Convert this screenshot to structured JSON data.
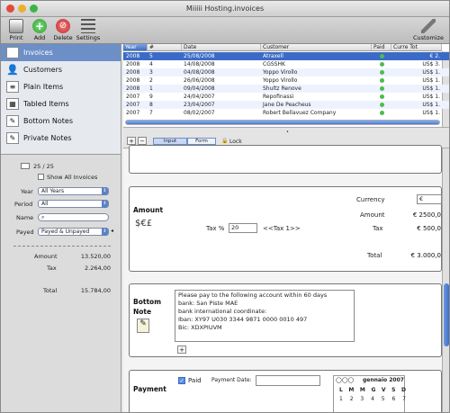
{
  "window": {
    "title": "Miiiii Hosting.invoices",
    "close_color": "#e04b3c",
    "min_color": "#e8b030",
    "max_color": "#3fb34a"
  },
  "toolbar": {
    "print": "Print",
    "add": "Add",
    "delete": "Delete",
    "settings": "Settings",
    "customize": "Customize"
  },
  "sidebar": {
    "items": [
      {
        "label": "Invoices",
        "icon": "invoice-icon"
      },
      {
        "label": "Customers",
        "icon": "person-icon"
      },
      {
        "label": "Plain Items",
        "icon": "document-icon"
      },
      {
        "label": "Tabled Items",
        "icon": "table-icon"
      },
      {
        "label": "Bottom Notes",
        "icon": "pencil-icon"
      },
      {
        "label": "Private Notes",
        "icon": "pencil-icon"
      }
    ]
  },
  "filter": {
    "count": "25 / 25",
    "show_all": "Show All Invoices",
    "year_label": "Year",
    "year_value": "All Years",
    "period_label": "Period",
    "period_value": "All",
    "name_label": "Name",
    "payed_label": "Payed",
    "payed_value": "Payed & Unpayed",
    "amount_label": "Amount",
    "amount_value": "13.520,00",
    "tax_label": "Tax",
    "tax_value": "2.264,00",
    "total_label": "Total",
    "total_value": "15.784,00"
  },
  "table": {
    "headers": [
      "Year",
      "#",
      "Date",
      "Customer",
      "Paid",
      "Curre Tot"
    ],
    "rows": [
      [
        "2008",
        "5",
        "25/08/2008",
        "Atraxell",
        "€ 2."
      ],
      [
        "2008",
        "4",
        "14/08/2008",
        "CGSSHK",
        "US$ 3."
      ],
      [
        "2008",
        "3",
        "04/08/2008",
        "Yoppo Virollo",
        "US$ 1."
      ],
      [
        "2008",
        "2",
        "26/06/2008",
        "Yoppo Virollo",
        "US$ 1."
      ],
      [
        "2008",
        "1",
        "09/04/2008",
        "Shultz Renove",
        "US$ 1."
      ],
      [
        "2007",
        "9",
        "24/04/2007",
        "Repofinassi",
        "US$ 1."
      ],
      [
        "2007",
        "8",
        "23/04/2007",
        "Jane De Peacheus",
        "US$ 1."
      ],
      [
        "2007",
        "7",
        "08/02/2007",
        "Robert Bellavuez Company",
        "US$ 1."
      ]
    ]
  },
  "tabbar": {
    "plus": "+",
    "minus": "−",
    "input": "Input",
    "form": "Form",
    "lock": "Lock"
  },
  "amount_section": {
    "title": "Amount",
    "currency_label": "Currency",
    "currency_value": "€",
    "amount_label": "Amount",
    "amount_value": "€  2500,0",
    "tax_pct_label": "Tax %",
    "tax_pct_value": "20",
    "tax_tag": "<<Tax 1>>",
    "tax_label": "Tax",
    "tax_value": "€  500,0",
    "total_label": "Total",
    "total_value": "€  3.000,0",
    "currency_symbols": "$€£"
  },
  "bottom_note": {
    "title": "Bottom Note",
    "lines": [
      "Please pay to the following account within 60 days",
      "bank: San Piste MAE",
      "bank international coordinate:",
      "Iban: XY97 U030 3344 9871 0000 0010 497",
      "Bic: XDXPIUVM"
    ],
    "add": "+"
  },
  "payment": {
    "title": "Payment",
    "paid_label": "Paid",
    "date_label": "Payment Date:",
    "cal_month": "gennaio 2007",
    "cal_days": [
      "L",
      "M",
      "M",
      "G",
      "V",
      "S",
      "D"
    ],
    "cal_row1": [
      "1",
      "2",
      "3",
      "4",
      "5",
      "6",
      "7"
    ]
  }
}
